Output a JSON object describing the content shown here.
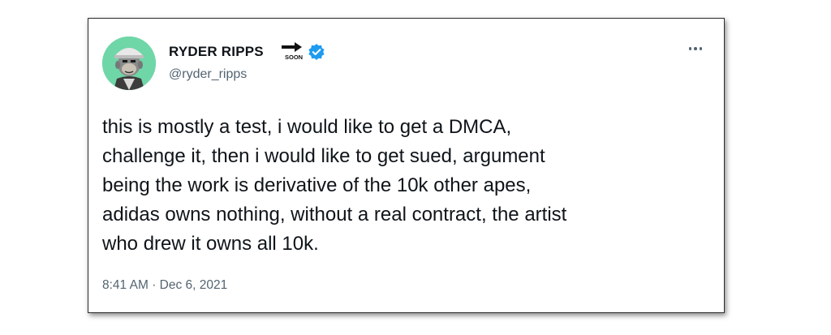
{
  "author": {
    "display_name": "RYDER RIPPS",
    "name_emoji": "soon-arrow-icon",
    "emoji_text": "SOON",
    "verified": true,
    "handle": "@ryder_ripps",
    "avatar": "ape-avatar"
  },
  "tweet": {
    "lines": [
      "this is mostly a test, i would like to get a DMCA,",
      "challenge it, then i would like to get sued, argument",
      "being the work is derivative of the 10k other apes,",
      "adidas owns nothing, without a real contract, the artist",
      "who drew it owns all 10k."
    ]
  },
  "meta": {
    "time": "8:41 AM",
    "separator": "·",
    "date": "Dec 6, 2021"
  },
  "colors": {
    "verified_blue": "#1d9bf0",
    "avatar_bg": "#6fd6a8",
    "text": "#0f1419",
    "secondary_text": "#536471"
  }
}
